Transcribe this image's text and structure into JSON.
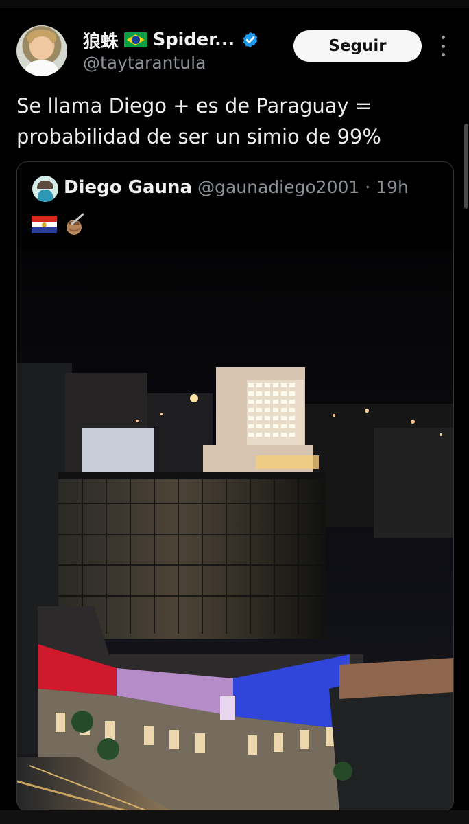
{
  "author": {
    "display_name": "狼蛛",
    "display_name_suffix": "Spider...",
    "handle": "@taytarantula"
  },
  "actions": {
    "follow_label": "Seguir"
  },
  "tweet": {
    "text": "Se llama Diego + es de Paraguay = probabilidad de ser un simio de 99%"
  },
  "quote": {
    "display_name": "Diego Gauna",
    "handle": "@gaunadiego2001",
    "separator": "·",
    "time": "19h"
  },
  "colors": {
    "background": "#000000",
    "text": "#e7e9ea",
    "muted": "#8e9399",
    "follow_background": "#f7f7f7",
    "verified": "#1d9bf0",
    "brazil_green": "#0c9f45",
    "brazil_yellow": "#ffd400",
    "brazil_blue": "#173f9e",
    "paraguay_red": "#d7261e",
    "paraguay_white": "#ffffff",
    "paraguay_blue": "#2a3d9d"
  },
  "icons": {
    "brazil_flag": "brazil-flag-icon",
    "verified": "verified-badge-icon",
    "more": "more-vertical-icon",
    "paraguay_flag": "paraguay-flag-icon",
    "mate": "mate-gourd-icon"
  }
}
